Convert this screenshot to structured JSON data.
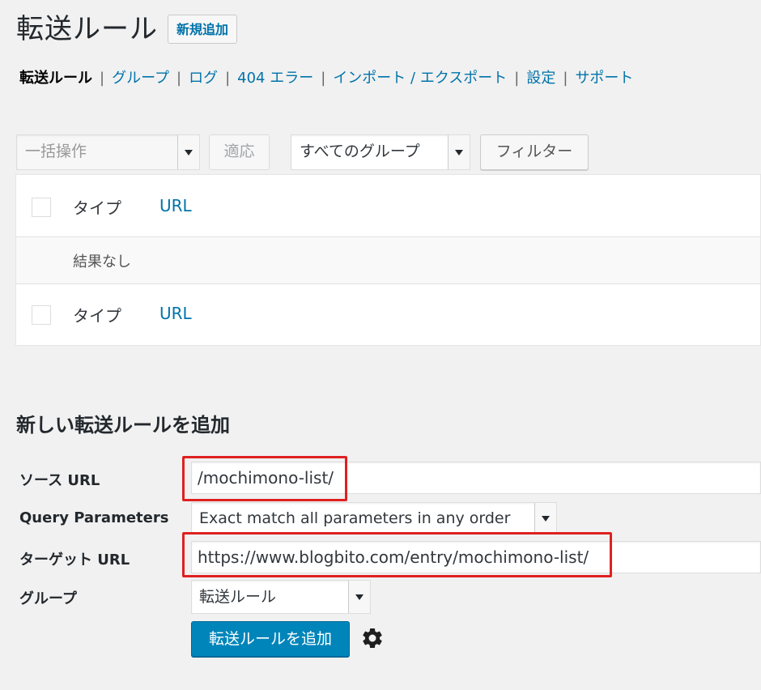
{
  "header": {
    "title": "転送ルール",
    "add_new_label": "新規追加"
  },
  "subnav": {
    "items": [
      {
        "label": "転送ルール",
        "current": true
      },
      {
        "label": "グループ"
      },
      {
        "label": "ログ"
      },
      {
        "label": "404 エラー"
      },
      {
        "label": "インポート / エクスポート"
      },
      {
        "label": "設定"
      },
      {
        "label": "サポート"
      }
    ],
    "separator": "|"
  },
  "toolbar": {
    "bulk_action": {
      "value": "一括操作",
      "arrow_icon": "chevron-down-icon"
    },
    "apply_label": "適応",
    "group_filter": {
      "value": "すべてのグループ",
      "arrow_icon": "chevron-down-icon"
    },
    "filter_label": "フィルター"
  },
  "table": {
    "columns": [
      "タイプ",
      "URL"
    ],
    "empty_message": "結果なし",
    "footer_columns": [
      "タイプ",
      "URL"
    ]
  },
  "add_form": {
    "heading": "新しい転送ルールを追加",
    "source_url": {
      "label": "ソース URL",
      "value": "/mochimono-list/"
    },
    "query_parameters": {
      "label": "Query Parameters",
      "value": "Exact match all parameters in any order"
    },
    "target_url": {
      "label": "ターゲット URL",
      "value": "https://www.blogbito.com/entry/mochimono-list/"
    },
    "group": {
      "label": "グループ",
      "value": "転送ルール"
    },
    "submit_label": "転送ルールを追加",
    "options_icon": "gear-icon"
  },
  "colors": {
    "link": "#0073aa",
    "primary": "#0085ba",
    "highlight": "#e02020",
    "background": "#f1f1f1"
  }
}
